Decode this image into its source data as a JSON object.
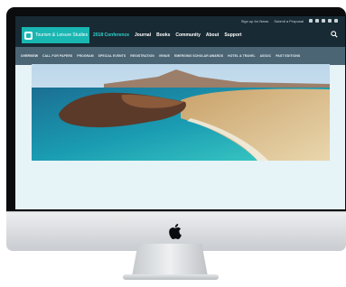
{
  "header": {
    "utility_links": [
      "Sign up for News",
      "Submit a Proposal"
    ],
    "social_icons": [
      "facebook-icon",
      "twitter-icon",
      "linkedin-icon",
      "instagram-icon",
      "youtube-icon"
    ],
    "logo_text": "Tourism & Leisure Studies",
    "nav": [
      "2018 Conference",
      "Journal",
      "Books",
      "Community",
      "About",
      "Support"
    ],
    "search_icon": "search-icon"
  },
  "sub_nav": [
    "OVERVIEW",
    "CALL FOR PAPERS",
    "PROGRAM",
    "SPECIAL EVENTS",
    "REGISTRATION",
    "VENUE",
    "EMERGING SCHOLAR AWARDS",
    "HOTEL & TRAVEL",
    "ASSOC",
    "PAST EDITIONS"
  ],
  "colors": {
    "top_bar": "#182a34",
    "logo": "#19b6b2",
    "accent": "#2dd6cf",
    "sub_nav": "#4b6575",
    "content_bg": "#e6f3f7"
  },
  "device": {
    "brand_icon": "apple-logo-icon"
  }
}
